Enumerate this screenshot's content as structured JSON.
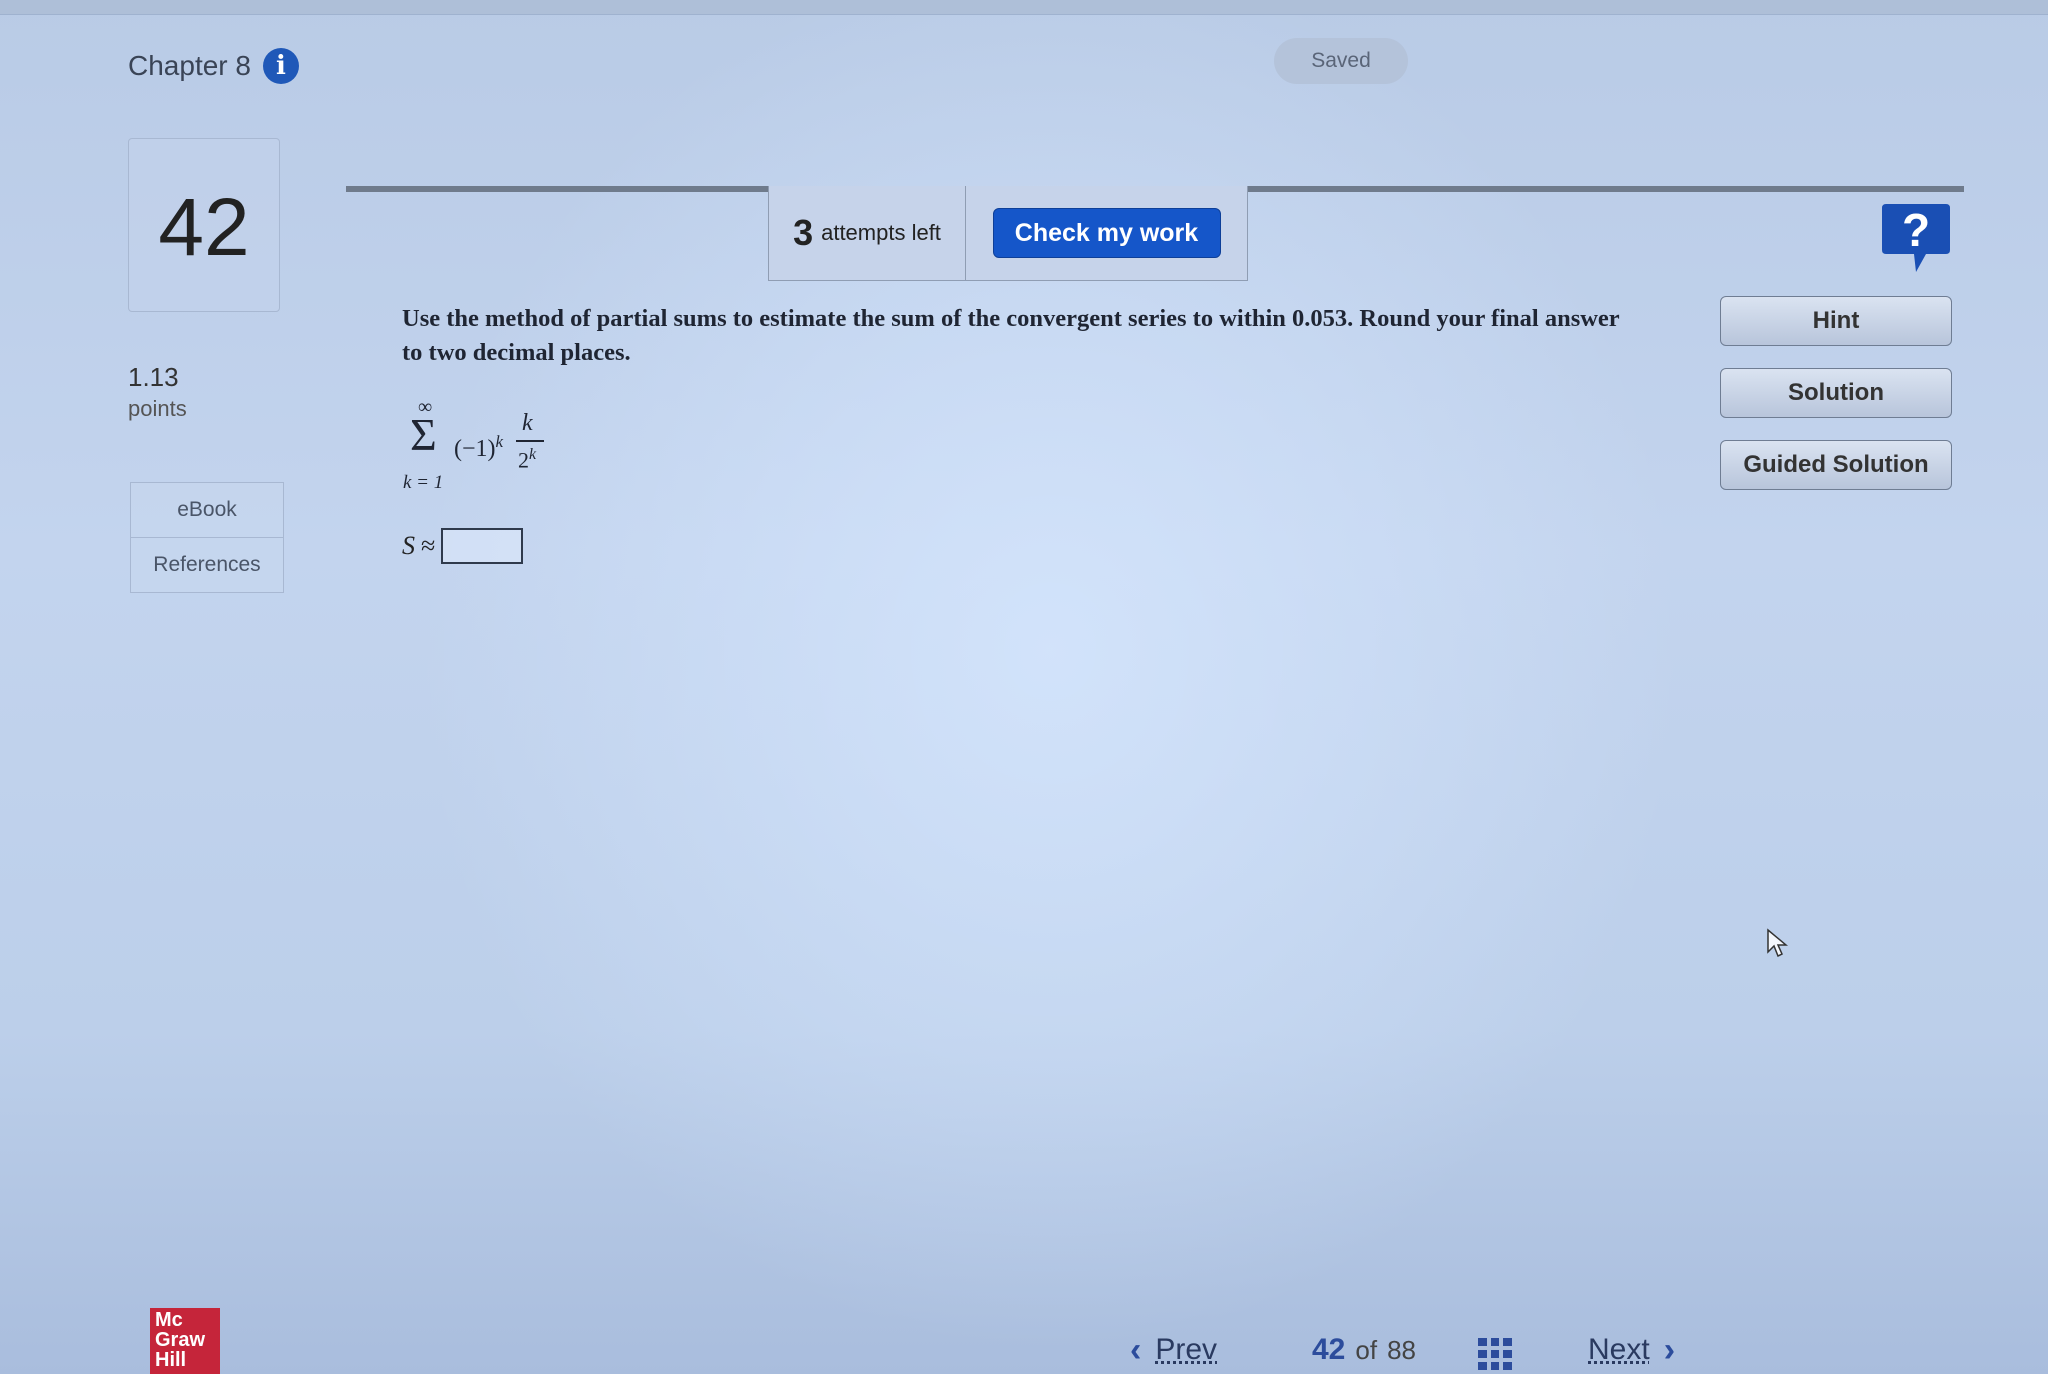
{
  "header": {
    "chapter": "Chapter 8",
    "info_icon": "info-icon",
    "status": "Saved"
  },
  "sidebar": {
    "question_number": "42",
    "points_value": "1.13",
    "points_label": "points",
    "links": [
      "eBook",
      "References"
    ]
  },
  "attempts": {
    "count": "3",
    "label": "attempts left",
    "check_button": "Check my work"
  },
  "question": {
    "text": "Use the method of partial sums to estimate the sum of the convergent series to within 0.053. Round your final answer to two decimal places.",
    "series": {
      "upper": "∞",
      "sigma": "Σ",
      "lower": "k = 1",
      "term_base": "(−1)",
      "term_exp": "k",
      "frac_num": "k",
      "frac_den_base": "2",
      "frac_den_exp": "k"
    },
    "answer_label": "S",
    "answer_symbol": "≈",
    "answer_value": ""
  },
  "help_buttons": {
    "help_icon": "question-mark-icon",
    "hint": "Hint",
    "solution": "Solution",
    "guided_solution": "Guided Solution"
  },
  "pagination": {
    "prev": "Prev",
    "current": "42",
    "of": "of",
    "total": "88",
    "next": "Next",
    "grid_icon": "grid-icon"
  },
  "logo": {
    "line1": "Mc",
    "line2": "Graw",
    "line3": "Hill",
    "color": "#c5253a"
  },
  "colors": {
    "accent": "#1556c9",
    "info": "#1f58b8"
  }
}
